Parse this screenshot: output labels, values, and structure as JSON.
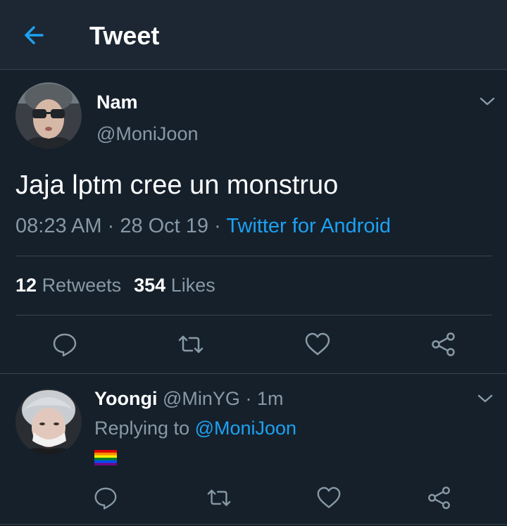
{
  "header": {
    "title": "Tweet"
  },
  "main_tweet": {
    "name": "Nam",
    "handle": "@MoniJoon",
    "text": "Jaja lptm cree un monstruo",
    "time": "08:23 AM",
    "sep1": " · ",
    "date": "28 Oct 19",
    "sep2": " · ",
    "source": "Twitter for Android",
    "retweets_count": "12",
    "retweets_label": "Retweets",
    "likes_count": "354",
    "likes_label": "Likes"
  },
  "reply": {
    "name": "Yoongi",
    "handle": "@MinYG",
    "sep": " · ",
    "time": "1m",
    "replying_prefix": "Replying to ",
    "replying_to": "@MoniJoon",
    "content_icon": "rainbow-flag-emoji"
  },
  "icons": {
    "back": "arrow-left-icon",
    "menu": "chevron-down-icon",
    "reply": "comment-icon",
    "retweet": "retweet-icon",
    "like": "heart-icon",
    "share": "share-icon"
  },
  "colors": {
    "background": "#15202b",
    "header_bg": "#1c2733",
    "accent": "#1da1f2",
    "secondary_text": "#8899a6",
    "divider": "#38444d"
  }
}
